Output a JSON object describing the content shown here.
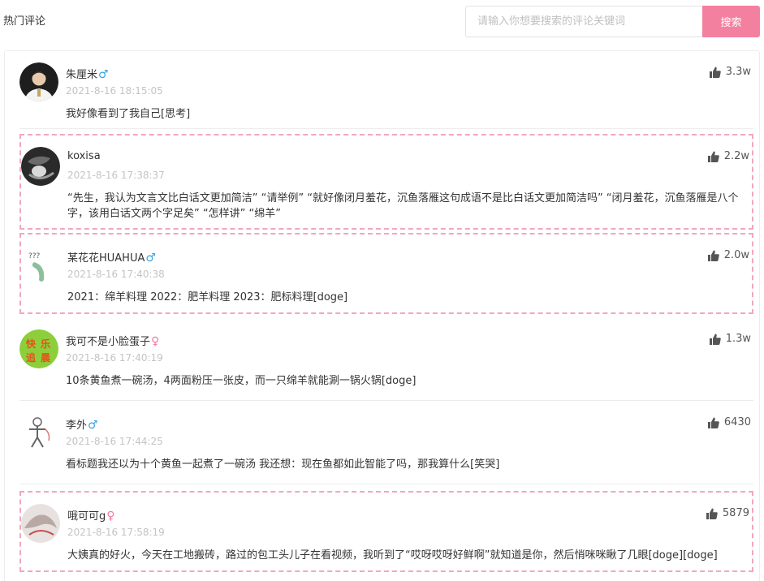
{
  "section_title": "热门评论",
  "search": {
    "placeholder": "请输入你想要搜索的评论关键词",
    "button_label": "搜索"
  },
  "colors": {
    "accent": "#f4809f",
    "highlight_border": "#f2a7bc",
    "male": "#3aa1e4",
    "female": "#f07aa0"
  },
  "comments": [
    {
      "username": "朱厘米",
      "gender": "♂",
      "time": "2021-8-16 18:15:05",
      "content": "我好像看到了我自己[思考]",
      "likes": "3.3w",
      "highlighted": false
    },
    {
      "username": "koxisa",
      "gender": "",
      "time": "2021-8-16 17:38:37",
      "content": "“先生，我认为文言文比白话文更加简洁” “请举例” “就好像闭月羞花，沉鱼落雁这句成语不是比白话文更加简洁吗” “闭月羞花，沉鱼落雁是八个字，该用白话文两个字足矣” “怎样讲” “绵羊”",
      "likes": "2.2w",
      "highlighted": true
    },
    {
      "username": "某花花HUAHUA",
      "gender": "♂",
      "time": "2021-8-16 17:40:38",
      "content": "2021：绵羊料理 2022：肥羊料理 2023：肥标料理[doge]",
      "likes": "2.0w",
      "highlighted": true
    },
    {
      "username": "我可不是小脸蛋子",
      "gender": "♀",
      "time": "2021-8-16 17:40:19",
      "content": "10条黄鱼煮一碗汤，4两面粉压一张皮，而一只绵羊就能涮一锅火锅[doge]",
      "likes": "1.3w",
      "highlighted": false,
      "avatar_text": [
        "快",
        "乐",
        "追",
        "晨"
      ]
    },
    {
      "username": "李外",
      "gender": "♂",
      "time": "2021-8-16 17:44:25",
      "content": "看标题我还以为十个黄鱼一起煮了一碗汤 我还想：现在鱼都如此智能了吗，那我算什么[笑哭]",
      "likes": "6430",
      "highlighted": false
    },
    {
      "username": "哦可可g",
      "gender": "♀",
      "time": "2021-8-16 17:58:19",
      "content": "大姨真的好火，今天在工地搬砖，路过的包工头儿子在看视频，我听到了“哎呀哎呀好鲜啊”就知道是你，然后悄咪咪瞅了几眼[doge][doge]",
      "likes": "5879",
      "highlighted": true
    }
  ]
}
